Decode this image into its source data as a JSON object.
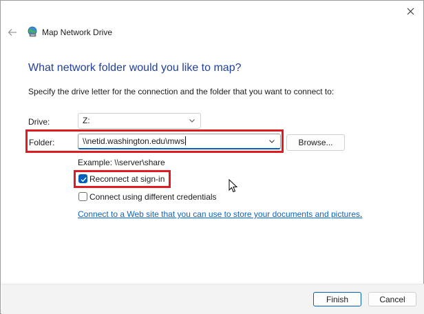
{
  "window": {
    "title": "Map Network Drive",
    "icons": {
      "back": "back-arrow-icon",
      "close": "close-icon",
      "app": "network-drive-icon"
    }
  },
  "main": {
    "heading": "What network folder would you like to map?",
    "instruction": "Specify the drive letter for the connection and the folder that you want to connect to:",
    "drive": {
      "label": "Drive:",
      "selected": "Z:"
    },
    "folder": {
      "label": "Folder:",
      "value": "\\\\netid.washington.edu\\mws"
    },
    "browse_label": "Browse...",
    "example": "Example: \\\\server\\share",
    "reconnect": {
      "label": "Reconnect at sign-in",
      "checked": true
    },
    "credentials": {
      "label": "Connect using different credentials",
      "checked": false
    },
    "web_link": "Connect to a Web site that you can use to store your documents and pictures",
    "web_link_suffix": "."
  },
  "footer": {
    "finish_label": "Finish",
    "cancel_label": "Cancel"
  },
  "colors": {
    "heading": "#1f3f9b",
    "accent": "#005fb8",
    "link": "#0a64c2",
    "highlight": "#e01a22"
  }
}
